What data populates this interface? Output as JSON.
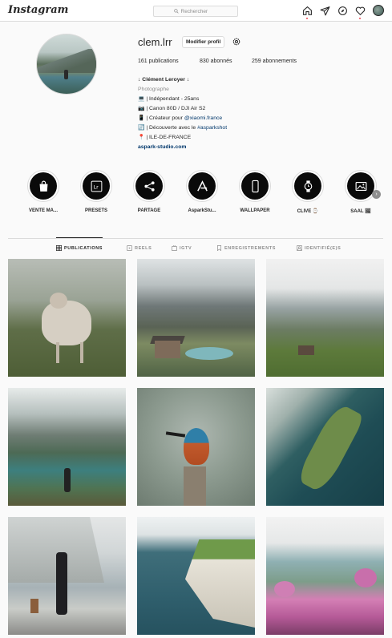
{
  "nav": {
    "logo": "Instagram",
    "search_placeholder": "Rechercher"
  },
  "profile": {
    "username": "clem.lrr",
    "edit_label": "Modifier profil",
    "stats": {
      "posts": "161 publications",
      "followers": "830 abonnés",
      "following": "259 abonnements"
    },
    "bio": {
      "name": "↓ Clément Leroyer ↓",
      "category": "Photographe",
      "line1": "💻 | Indépendant - 25ans",
      "line2": "📷 | Canon 80D / DJI Air S2",
      "line3_prefix": "📱 | Créateur pour ",
      "line3_mention": "@xiaomi.france",
      "line4_prefix": "🔄 | Découverte avec le ",
      "line4_tag": "#asparkshot",
      "line5": "📍 | ILE-DE-FRANCE",
      "website": "aspark-studio.com"
    }
  },
  "highlights": [
    {
      "label": "VENTE MA...",
      "icon": "shopping-bag-icon"
    },
    {
      "label": "PRESETS",
      "icon": "lightroom-icon"
    },
    {
      "label": "PARTAGE",
      "icon": "share-icon"
    },
    {
      "label": "AsparkStu...",
      "icon": "aspark-logo-icon"
    },
    {
      "label": "WALLPAPER",
      "icon": "phone-icon"
    },
    {
      "label": "CLIVE ⌚",
      "icon": "watch-icon"
    },
    {
      "label": "SAAL 🖼",
      "icon": "image-frame-icon"
    }
  ],
  "tabs": [
    {
      "label": "PUBLICATIONS",
      "icon": "grid-icon",
      "active": true
    },
    {
      "label": "REELS",
      "icon": "reels-icon",
      "active": false
    },
    {
      "label": "IGTV",
      "icon": "igtv-icon",
      "active": false
    },
    {
      "label": "ENREGISTREMENTS",
      "icon": "bookmark-icon",
      "active": false
    },
    {
      "label": "IDENTIFIÉ(E)S",
      "icon": "tag-icon",
      "active": false
    }
  ],
  "colors": {
    "accent_link": "#00376b",
    "notification": "#ed4956",
    "border": "#dbdbdb",
    "muted": "#8e8e8e"
  }
}
